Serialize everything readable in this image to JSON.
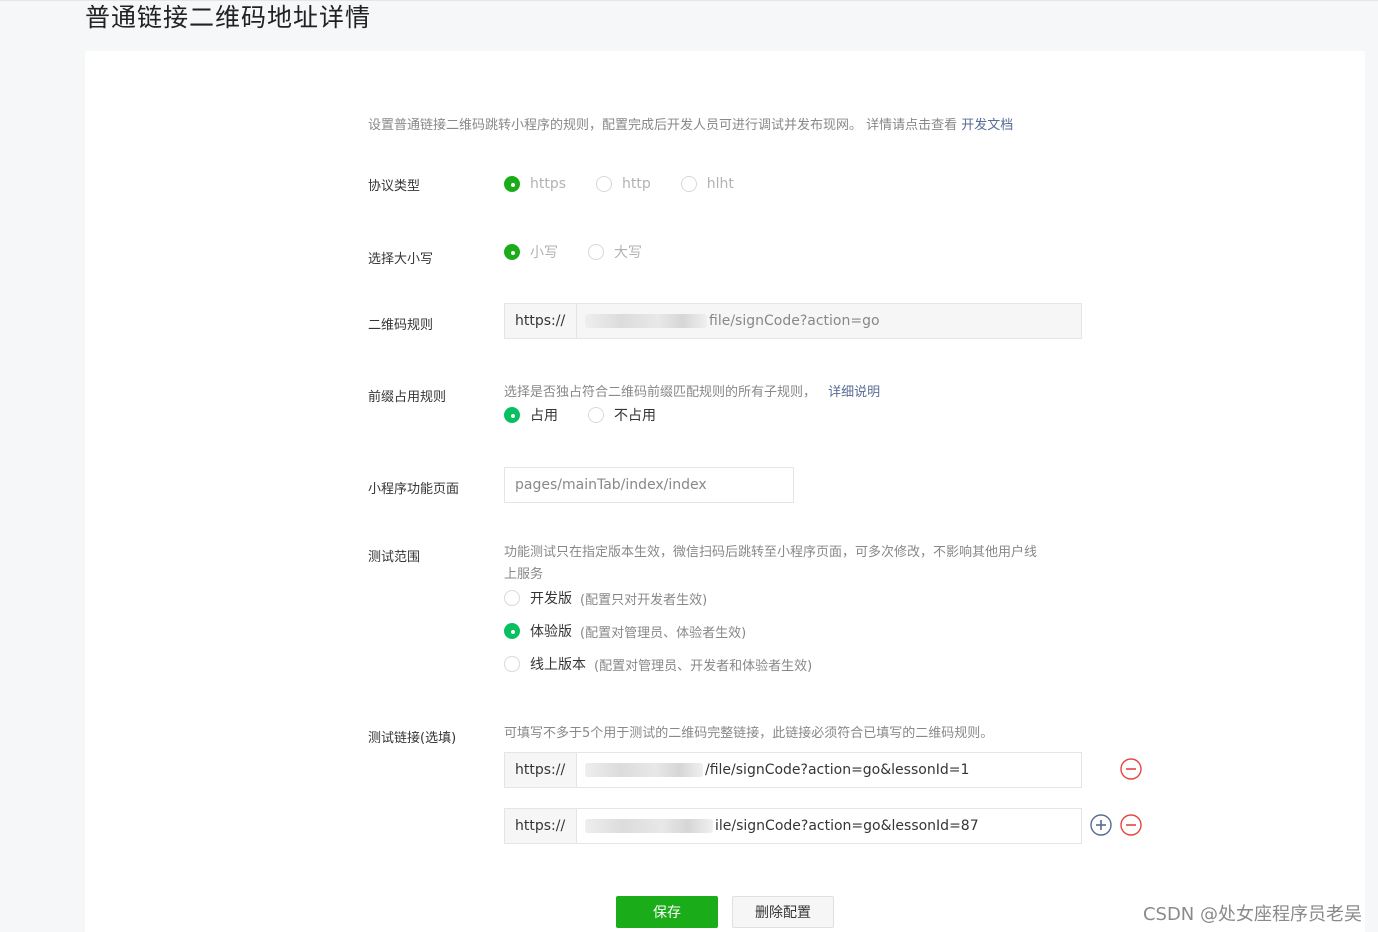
{
  "page": {
    "title": "普通链接二维码地址详情"
  },
  "intro": {
    "text": "设置普通链接二维码跳转小程序的规则，配置完成后开发人员可进行调试并发布现网。 详情请点击查看 ",
    "link": "开发文档"
  },
  "protocol": {
    "label": "协议类型",
    "options": [
      "https",
      "http",
      "hlht"
    ],
    "selected": "https"
  },
  "case": {
    "label": "选择大小写",
    "options": [
      "小写",
      "大写"
    ],
    "selected": "小写"
  },
  "qr_rule": {
    "label": "二维码规则",
    "prefix": "https://",
    "value_suffix": "file/signCode?action=go"
  },
  "prefix_rule": {
    "label": "前缀占用规则",
    "desc": "选择是否独占符合二维码前缀匹配规则的所有子规则，",
    "link": "详细说明",
    "options": [
      "占用",
      "不占用"
    ],
    "selected": "占用"
  },
  "page_path": {
    "label": "小程序功能页面",
    "value": "pages/mainTab/index/index"
  },
  "test_scope": {
    "label": "测试范围",
    "desc_line1": "功能测试只在指定版本生效，微信扫码后跳转至小程序页面，可多次修改，不影响其他用户线",
    "desc_line2": "上服务",
    "options": [
      {
        "label": "开发版",
        "note": "(配置只对开发者生效)"
      },
      {
        "label": "体验版",
        "note": "(配置对管理员、体验者生效)"
      },
      {
        "label": "线上版本",
        "note": "(配置对管理员、开发者和体验者生效)"
      }
    ],
    "selected": "体验版"
  },
  "test_links": {
    "label": "测试链接(选填)",
    "desc": "可填写不多于5个用于测试的二维码完整链接，此链接必须符合已填写的二维码规则。",
    "prefix": "https://",
    "links": [
      {
        "value_suffix": "/file/signCode?action=go&lessonId=1"
      },
      {
        "value_suffix": "ile/signCode?action=go&lessonId=87"
      }
    ]
  },
  "actions": {
    "save": "保存",
    "delete": "删除配置"
  },
  "watermark": "CSDN @处女座程序员老吴",
  "colors": {
    "primary_green": "#1aad19",
    "radio_green": "#07c160",
    "link_blue": "#576b95",
    "remove_red": "#e64340",
    "add_blue": "#576b95"
  }
}
